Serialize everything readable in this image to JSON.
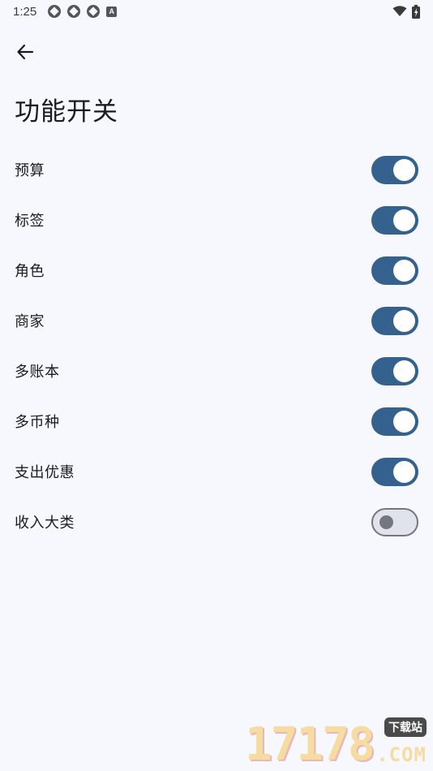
{
  "status_bar": {
    "time": "1:25",
    "icons_left": [
      "notification-icon",
      "notification-icon",
      "notification-icon",
      "a-icon"
    ],
    "a_icon_text": "A",
    "icons_right": [
      "wifi-icon",
      "battery-icon"
    ]
  },
  "app_bar": {
    "back_icon": "arrow-left-icon",
    "title": "功能开关"
  },
  "settings": [
    {
      "label": "预算",
      "enabled": true
    },
    {
      "label": "标签",
      "enabled": true
    },
    {
      "label": "角色",
      "enabled": true
    },
    {
      "label": "商家",
      "enabled": true
    },
    {
      "label": "多账本",
      "enabled": true
    },
    {
      "label": "多币种",
      "enabled": true
    },
    {
      "label": "支出优惠",
      "enabled": true
    },
    {
      "label": "收入大类",
      "enabled": false
    }
  ],
  "colors": {
    "background": "#f7f8fd",
    "toggle_on": "#34618e",
    "toggle_off_track": "#e0e2ec",
    "toggle_off_outline": "#74777f"
  },
  "watermark": {
    "digits": "17178",
    "badge": "下载站",
    "suffix": ".COM"
  }
}
